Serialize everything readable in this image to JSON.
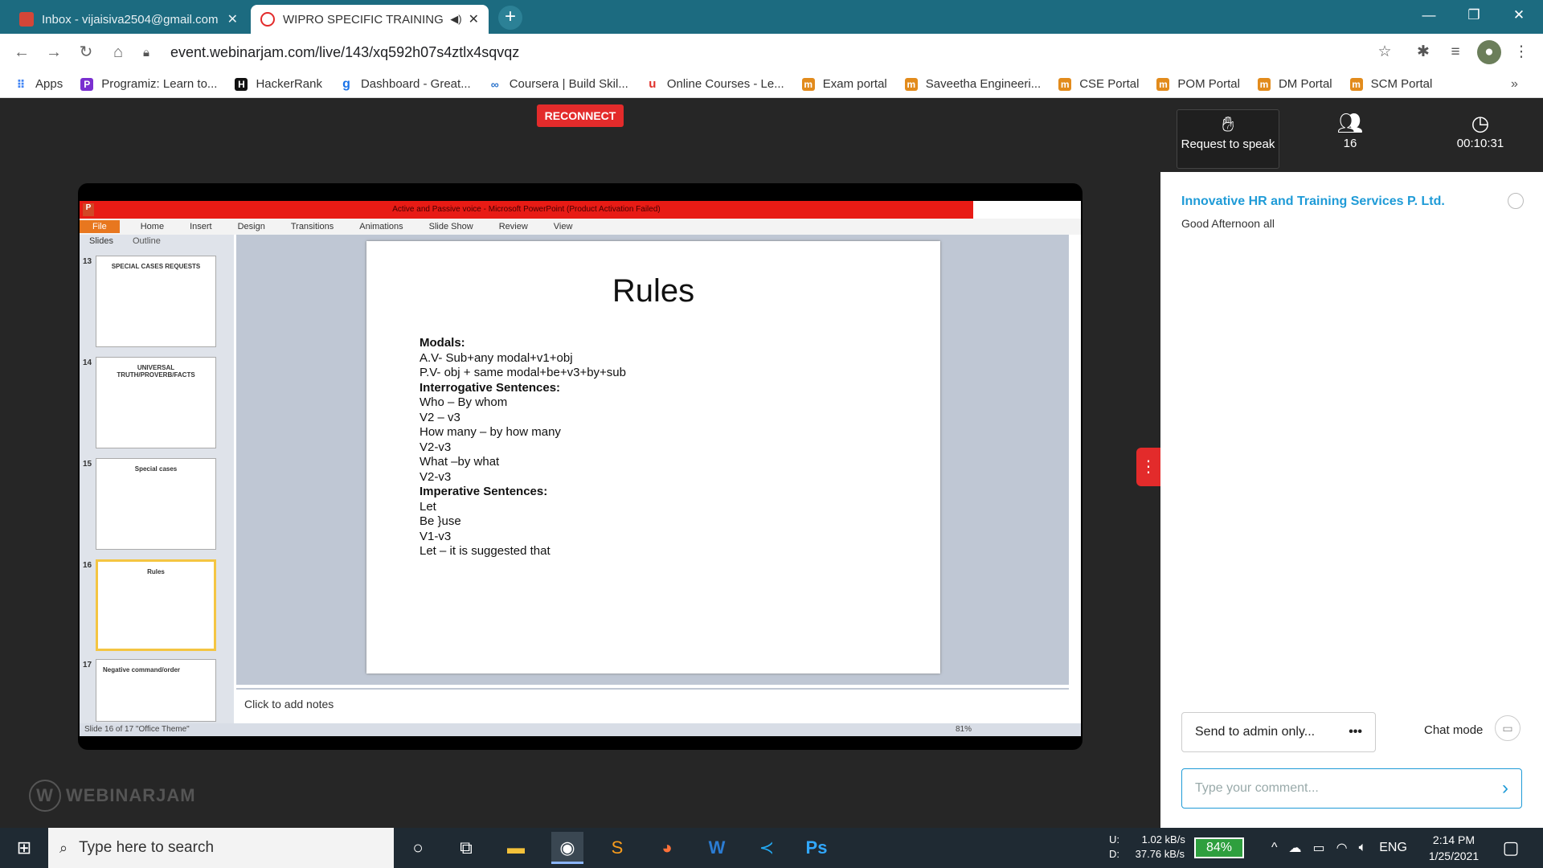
{
  "browser": {
    "tabs": [
      {
        "title": "Inbox - vijaisiva2504@gmail.com",
        "close": "✕"
      },
      {
        "title": "WIPRO SPECIFIC TRAINING -",
        "close": "✕"
      }
    ],
    "url": "event.webinarjam.com/live/143/xq592h07s4ztlx4sqvqz",
    "bookmarks": [
      "Apps",
      "Programiz: Learn to...",
      "HackerRank",
      "Dashboard - Great...",
      "Coursera | Build Skil...",
      "Online Courses - Le...",
      "Exam portal",
      "Saveetha Engineeri...",
      "CSE Portal",
      "POM Portal",
      "DM Portal",
      "SCM Portal"
    ]
  },
  "stage": {
    "reconnect": "RECONNECT",
    "logo": "WEBINARJAM"
  },
  "ppt": {
    "title": "Active and Passive voice - Microsoft PowerPoint (Product Activation Failed)",
    "menu": [
      "File",
      "Home",
      "Insert",
      "Design",
      "Transitions",
      "Animations",
      "Slide Show",
      "Review",
      "View"
    ],
    "pane_tabs": [
      "Slides",
      "Outline"
    ],
    "thumbs": [
      {
        "num": "13",
        "title": "SPECIAL CASES REQUESTS"
      },
      {
        "num": "14",
        "title": "UNIVERSAL TRUTH/PROVERB/FACTS"
      },
      {
        "num": "15",
        "title": "Special cases"
      },
      {
        "num": "16",
        "title": "Rules"
      },
      {
        "num": "17",
        "title": "Negative command/order"
      }
    ],
    "slide_title": "Rules",
    "slide_lines": [
      {
        "text": "Modals:",
        "bold": true
      },
      {
        "text": "A.V- Sub+any modal+v1+obj",
        "bold": false
      },
      {
        "text": "P.V- obj + same modal+be+v3+by+sub",
        "bold": false
      },
      {
        "text": "Interrogative Sentences:",
        "bold": true
      },
      {
        "text": "Who – By whom",
        "bold": false
      },
      {
        "text": "V2 – v3",
        "bold": false
      },
      {
        "text": "How many – by how many",
        "bold": false
      },
      {
        "text": "V2-v3",
        "bold": false
      },
      {
        "text": "What –by what",
        "bold": false
      },
      {
        "text": "V2-v3",
        "bold": false
      },
      {
        "text": "Imperative Sentences:",
        "bold": true
      },
      {
        "text": "Let",
        "bold": false
      },
      {
        "text": "Be  }use",
        "bold": false
      },
      {
        "text": "V1-v3",
        "bold": false
      },
      {
        "text": "Let – it is suggested that",
        "bold": false
      }
    ],
    "notes": "Click to add notes",
    "status": "Slide 16 of 17    \"Office Theme\"",
    "zoom": "81%"
  },
  "panel": {
    "request": "Request to speak",
    "attendees": "16",
    "timer": "00:10:31",
    "chat_from": "Innovative HR and Training Services P. Ltd.",
    "chat_msg": "Good Afternoon all",
    "send_to": "Send to admin only...",
    "chat_mode": "Chat mode",
    "comment_placeholder": "Type your comment..."
  },
  "taskbar": {
    "search": "Type here to search",
    "up": "U:",
    "down": "D:",
    "up_speed": "1.02 kB/s",
    "down_speed": "37.76 kB/s",
    "battery": "84%",
    "lang": "ENG",
    "time": "2:14 PM",
    "date": "1/25/2021"
  }
}
